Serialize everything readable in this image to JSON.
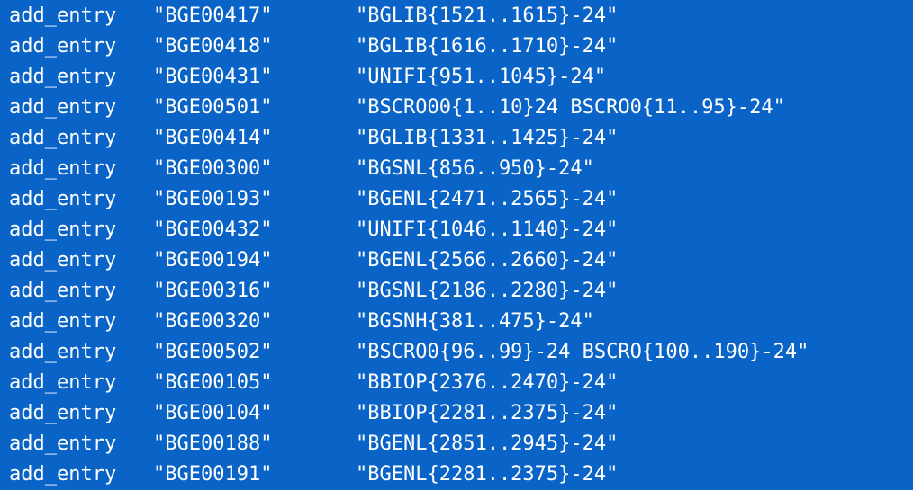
{
  "lines": [
    {
      "command": "add_entry",
      "id": "\"BGE00417\"",
      "range": "\"BGLIB{1521..1615}-24\""
    },
    {
      "command": "add_entry",
      "id": "\"BGE00418\"",
      "range": "\"BGLIB{1616..1710}-24\""
    },
    {
      "command": "add_entry",
      "id": "\"BGE00431\"",
      "range": "\"UNIFI{951..1045}-24\""
    },
    {
      "command": "add_entry",
      "id": "\"BGE00501\"",
      "range": "\"BSCRO00{1..10}24 BSCRO0{11..95}-24\""
    },
    {
      "command": "add_entry",
      "id": "\"BGE00414\"",
      "range": "\"BGLIB{1331..1425}-24\""
    },
    {
      "command": "add_entry",
      "id": "\"BGE00300\"",
      "range": "\"BGSNL{856..950}-24\""
    },
    {
      "command": "add_entry",
      "id": "\"BGE00193\"",
      "range": "\"BGENL{2471..2565}-24\""
    },
    {
      "command": "add_entry",
      "id": "\"BGE00432\"",
      "range": "\"UNIFI{1046..1140}-24\""
    },
    {
      "command": "add_entry",
      "id": "\"BGE00194\"",
      "range": "\"BGENL{2566..2660}-24\""
    },
    {
      "command": "add_entry",
      "id": "\"BGE00316\"",
      "range": "\"BGSNL{2186..2280}-24\""
    },
    {
      "command": "add_entry",
      "id": "\"BGE00320\"",
      "range": "\"BGSNH{381..475}-24\""
    },
    {
      "command": "add_entry",
      "id": "\"BGE00502\"",
      "range": "\"BSCRO0{96..99}-24 BSCRO{100..190}-24\""
    },
    {
      "command": "add_entry",
      "id": "\"BGE00105\"",
      "range": "\"BBIOP{2376..2470}-24\""
    },
    {
      "command": "add_entry",
      "id": "\"BGE00104\"",
      "range": "\"BBIOP{2281..2375}-24\""
    },
    {
      "command": "add_entry",
      "id": "\"BGE00188\"",
      "range": "\"BGENL{2851..2945}-24\""
    },
    {
      "command": "add_entry",
      "id": "\"BGE00191\"",
      "range": "\"BGENL{2281..2375}-24\""
    }
  ],
  "colors": {
    "background": "#0a64c8",
    "text": "#ffffff"
  }
}
